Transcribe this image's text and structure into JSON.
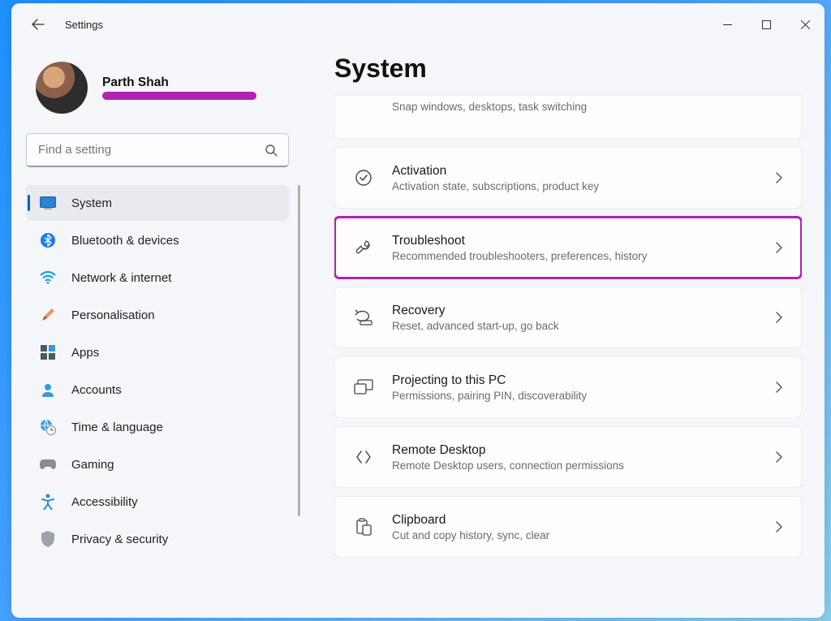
{
  "app_title": "Settings",
  "user": {
    "name": "Parth Shah"
  },
  "search": {
    "placeholder": "Find a setting"
  },
  "page_title": "System",
  "nav": [
    {
      "id": "system",
      "label": "System",
      "active": true
    },
    {
      "id": "bluetooth",
      "label": "Bluetooth & devices"
    },
    {
      "id": "network",
      "label": "Network & internet"
    },
    {
      "id": "personalisation",
      "label": "Personalisation"
    },
    {
      "id": "apps",
      "label": "Apps"
    },
    {
      "id": "accounts",
      "label": "Accounts"
    },
    {
      "id": "time",
      "label": "Time & language"
    },
    {
      "id": "gaming",
      "label": "Gaming"
    },
    {
      "id": "accessibility",
      "label": "Accessibility"
    },
    {
      "id": "privacy",
      "label": "Privacy & security"
    }
  ],
  "cards": {
    "multitask_sub": "Snap windows, desktops, task switching",
    "activation": {
      "title": "Activation",
      "sub": "Activation state, subscriptions, product key"
    },
    "troubleshoot": {
      "title": "Troubleshoot",
      "sub": "Recommended troubleshooters, preferences, history"
    },
    "recovery": {
      "title": "Recovery",
      "sub": "Reset, advanced start-up, go back"
    },
    "projecting": {
      "title": "Projecting to this PC",
      "sub": "Permissions, pairing PIN, discoverability"
    },
    "remote": {
      "title": "Remote Desktop",
      "sub": "Remote Desktop users, connection permissions"
    },
    "clipboard": {
      "title": "Clipboard",
      "sub": "Cut and copy history, sync, clear"
    }
  }
}
